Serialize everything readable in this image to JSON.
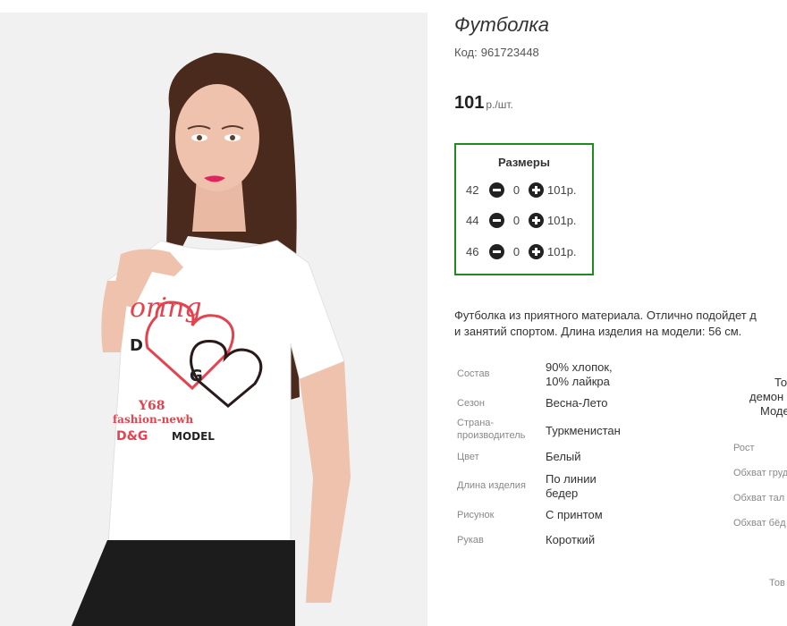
{
  "product": {
    "title": "Футболка",
    "sku_label": "Код:",
    "sku": "961723448",
    "price": "101",
    "price_unit": "р./шт."
  },
  "sizes": {
    "title": "Размеры",
    "rows": [
      {
        "size": "42",
        "qty": "0",
        "price": "101р."
      },
      {
        "size": "44",
        "qty": "0",
        "price": "101р."
      },
      {
        "size": "46",
        "qty": "0",
        "price": "101р."
      }
    ]
  },
  "description": {
    "line1": "Футболка из приятного материала. Отлично подойдет д",
    "line2": "и занятий спортом. Длина изделия на модели: 56 см."
  },
  "specs": [
    {
      "label": "Состав",
      "value_1": "90% хлопок,",
      "value_2": "10% лайкра"
    },
    {
      "label": "Сезон",
      "value_1": "Весна-Лето",
      "value_2": ""
    },
    {
      "label_1": "Страна-",
      "label_2": "производитель",
      "value_1": "Туркменистан"
    },
    {
      "label": "Цвет",
      "value_1": "Белый"
    },
    {
      "label": "Длина изделия",
      "value_1": "По линии",
      "value_2": "бедер"
    },
    {
      "label": "Рисунок",
      "value_1": "С принтом"
    },
    {
      "label": "Рукав",
      "value_1": "Короткий"
    }
  ],
  "model": {
    "heading_1": "То",
    "heading_2": "демон",
    "heading_3": "Моде",
    "rows": [
      "Рост",
      "Обхват груд",
      "Обхват тал",
      "Обхват бёд"
    ],
    "footer": "Тов"
  },
  "photo": {
    "print_line_1": "oring",
    "print_d": "D",
    "print_g": "G",
    "print_line_2": "Y68",
    "print_line_3": "fashion-newh",
    "print_line_4": "D&G",
    "print_line_5": "MODEL"
  }
}
